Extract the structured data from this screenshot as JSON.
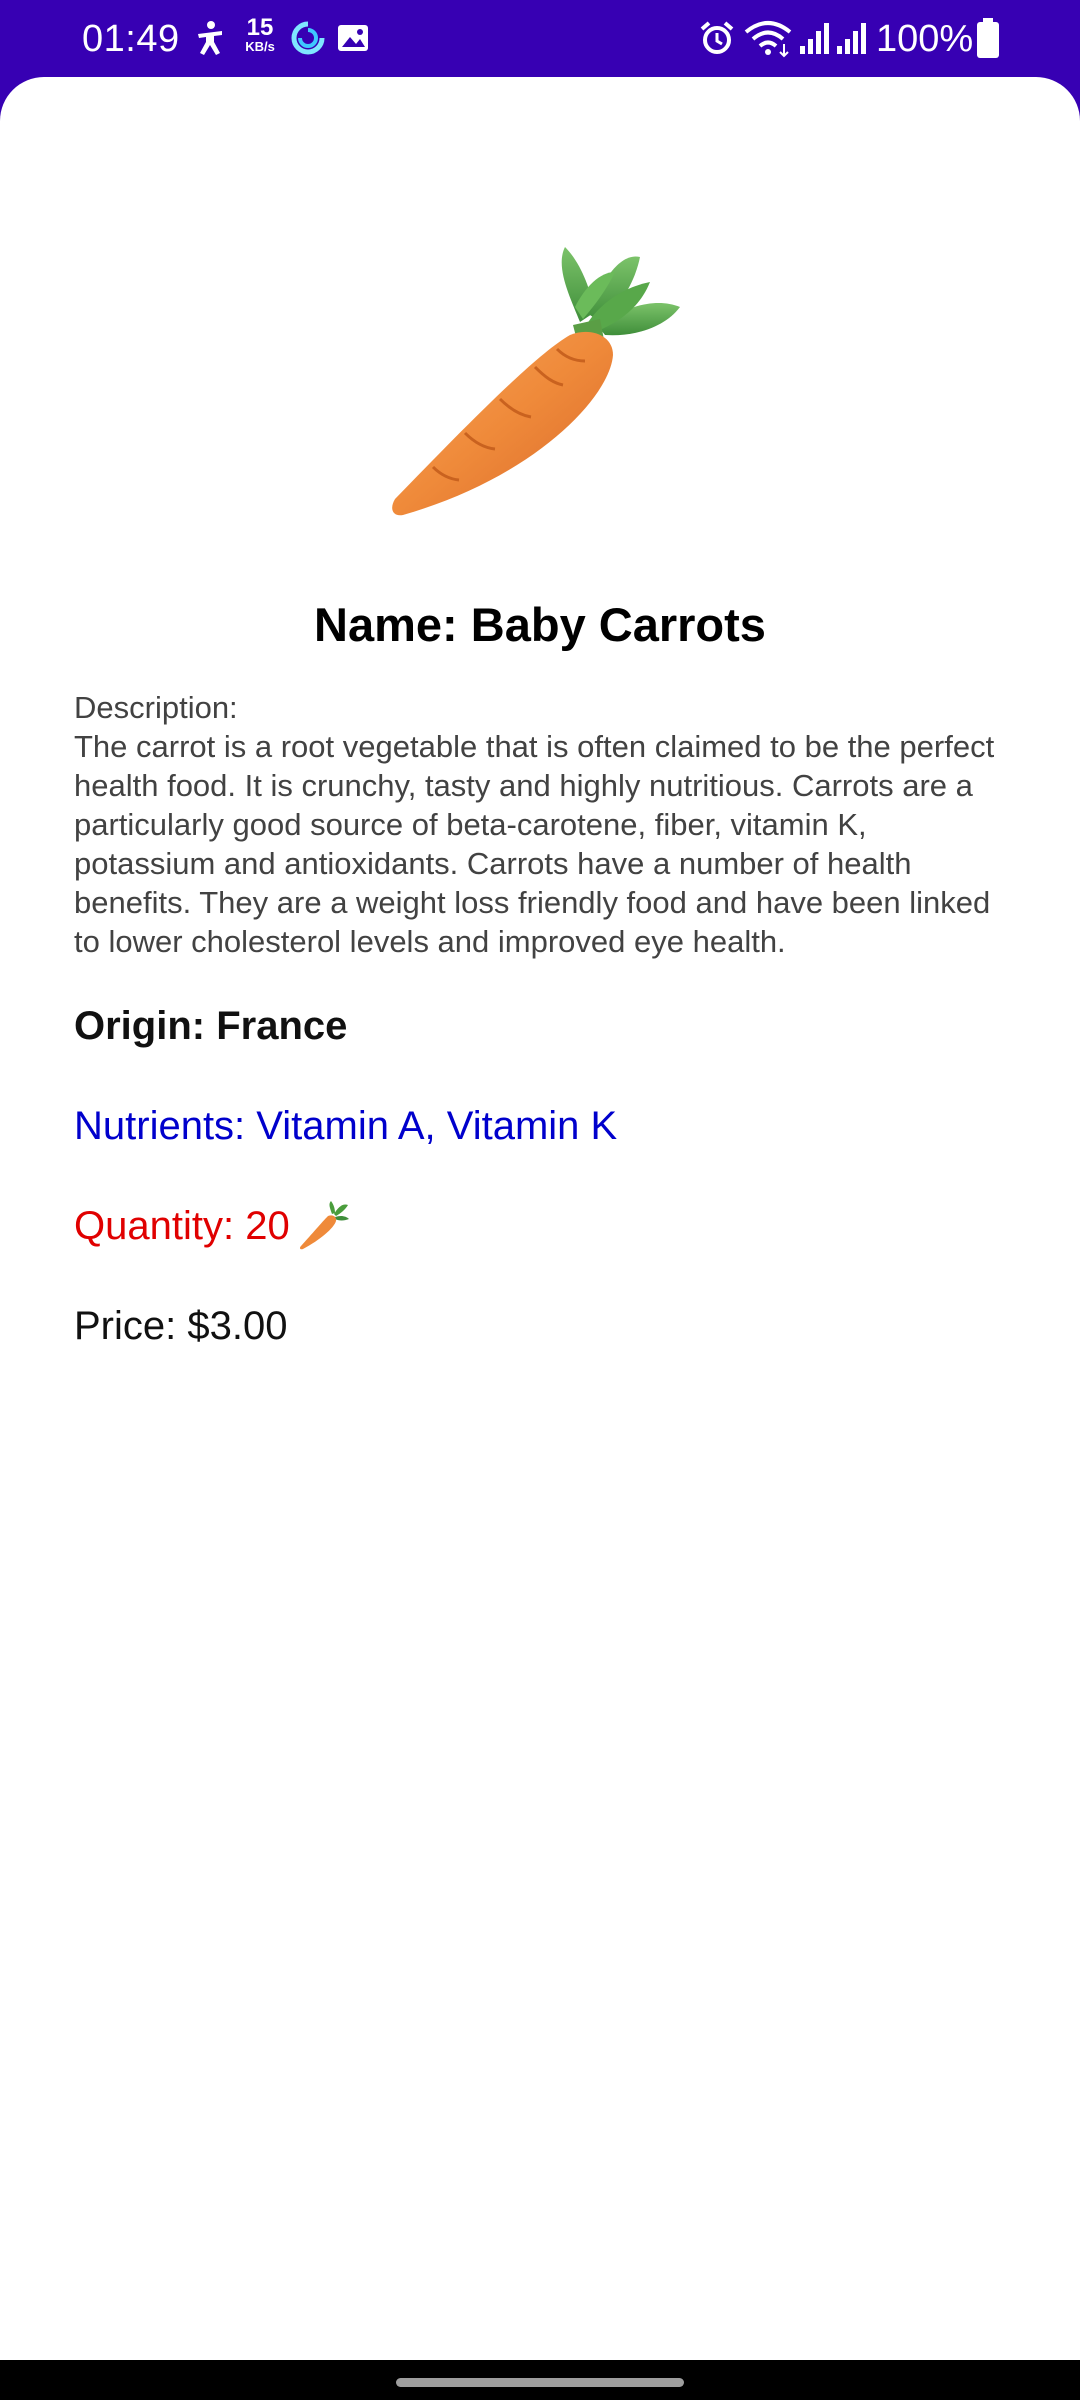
{
  "status_bar": {
    "time": "01:49",
    "network_speed_value": "15",
    "network_speed_unit": "KB/s",
    "battery_percent": "100%",
    "icons": [
      "accessibility-icon",
      "data-saver-icon",
      "gallery-icon",
      "alarm-icon",
      "wifi-icon",
      "signal-icon",
      "signal-icon",
      "battery-icon"
    ]
  },
  "product": {
    "image_icon": "carrot-icon",
    "name_label": "Name:",
    "name": "Baby Carrots",
    "description_label": "Description:",
    "description": "The carrot is a root vegetable that is often claimed to be the perfect health food. It is crunchy, tasty and highly nutritious. Carrots are a particularly good source of beta-carotene, fiber, vitamin K, potassium and antioxidants. Carrots have a number of health benefits. They are a weight loss friendly food and have been linked to lower cholesterol levels and improved eye health.",
    "origin_label": "Origin:",
    "origin": "France",
    "nutrients_label": "Nutrients:",
    "nutrients": "Vitamin A, Vitamin K",
    "quantity_label": "Quantity:",
    "quantity": "20",
    "price_label": "Price:",
    "price": "$3.00"
  },
  "colors": {
    "status_bar": "#3700b3",
    "nutrients": "#0000cc",
    "quantity": "#e00000",
    "background": "#ffffff"
  }
}
